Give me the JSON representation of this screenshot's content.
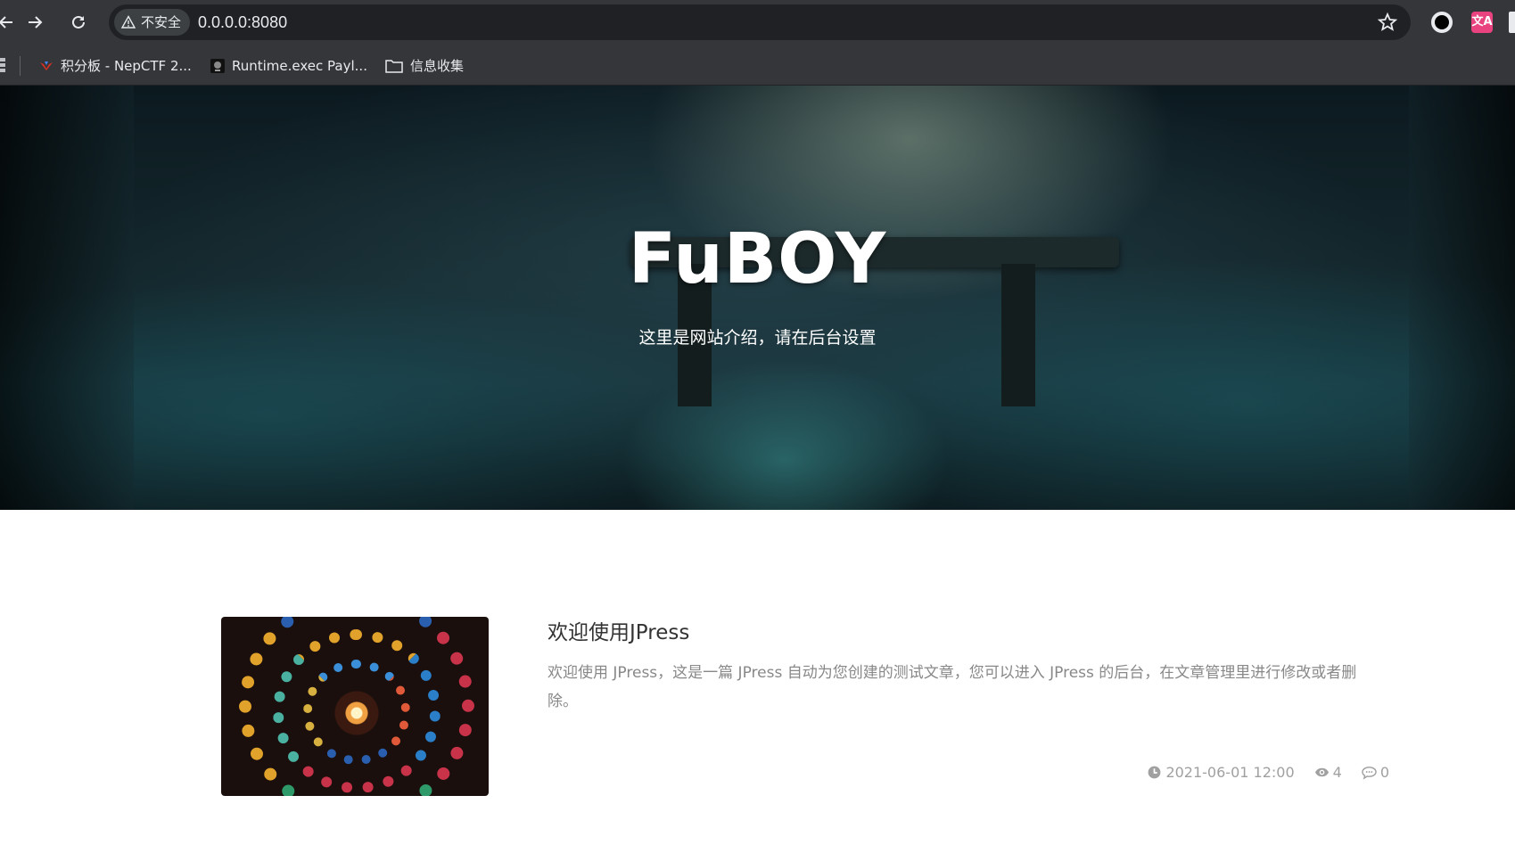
{
  "browser": {
    "security_label": "不安全",
    "url": "0.0.0.0:8080",
    "bookmarks": [
      {
        "label": "积分板 - NepCTF 2..."
      },
      {
        "label": "Runtime.exec Payl..."
      },
      {
        "label": "信息收集"
      }
    ],
    "translate_ext_label": "文A"
  },
  "hero": {
    "title": "FuBOY",
    "subtitle": "这里是网站介绍，请在后台设置"
  },
  "articles": [
    {
      "title": "欢迎使用JPress",
      "summary": "欢迎使用 JPress，这是一篇 JPress 自动为您创建的测试文章，您可以进入 JPress 的后台，在文章管理里进行修改或者删除。",
      "date": "2021-06-01 12:00",
      "views": "4",
      "comments": "0"
    }
  ],
  "colors": {
    "chrome_bg": "#35363a",
    "omnibox_bg": "#202124",
    "title_text": "#333333",
    "summary_text": "#888888",
    "meta_text": "#a0a0a0"
  }
}
